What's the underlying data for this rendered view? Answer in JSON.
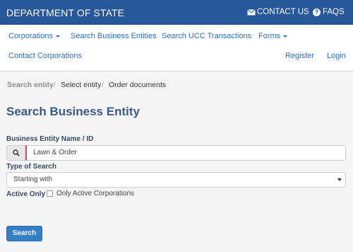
{
  "topbar": {
    "brand": "DEPARTMENT OF STATE",
    "contact_label": "CONTACT US",
    "contact_icon": "envelope-icon",
    "faqs_label": "FAQS",
    "faqs_icon": "question-circle-icon",
    "background": "#25579a"
  },
  "nav": {
    "corporations": "Corporations",
    "search_business": "Search Business Entities",
    "search_ucc": "Search UCC Transactions",
    "forms": "Forms",
    "contact_corporations": "Contact Corporations",
    "register": "Register",
    "login": "Login",
    "link_color": "#2a6fba"
  },
  "breadcrumb": {
    "items": [
      "Search entity",
      "Select entity",
      "Order documents"
    ],
    "separator": "/"
  },
  "page_title": "Search Business Entity",
  "form": {
    "entity_label": "Business Entity Name / ID",
    "entity_value": "Lawn & Order",
    "search_icon": "search-icon",
    "type_label": "Type of Search",
    "type_value": "Starting with",
    "active_label": "Active Only",
    "active_checkbox_label": "Only Active Corporations",
    "active_checked": false,
    "submit_label": "Search",
    "button_color": "#3180c8"
  }
}
